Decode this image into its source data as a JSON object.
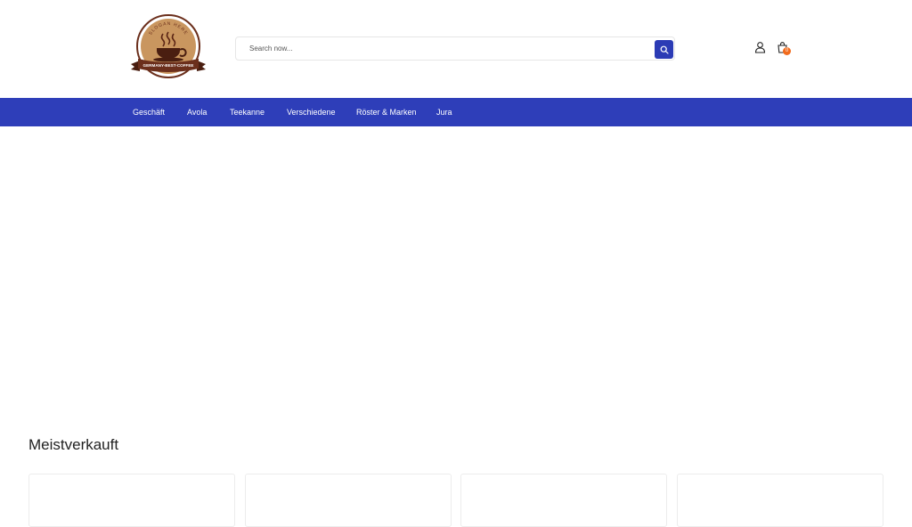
{
  "brand": {
    "logo_icon": "coffee-cup-logo",
    "logo_arc_text": "SLOGAN HERE",
    "logo_ribbon_text": "GERMANY-BEST-COFFEE",
    "colors": {
      "primary": "#2e3eb9",
      "badge": "#f26b1d",
      "logo_brown": "#6b2f1c",
      "logo_tan": "#c9965f"
    }
  },
  "search": {
    "placeholder": "Search now...",
    "value": "",
    "button_icon": "search-icon"
  },
  "header_actions": {
    "user_icon": "user-icon",
    "cart_icon": "shopping-bag-icon",
    "cart_count": "0"
  },
  "nav": {
    "items": [
      {
        "label": "Geschäft"
      },
      {
        "label": "Avola"
      },
      {
        "label": "Teekanne"
      },
      {
        "label": "Verschiedene"
      },
      {
        "label": "Röster & Marken"
      },
      {
        "label": "Jura"
      }
    ]
  },
  "bestsellers": {
    "title": "Meistverkauft",
    "card_count": 4
  }
}
